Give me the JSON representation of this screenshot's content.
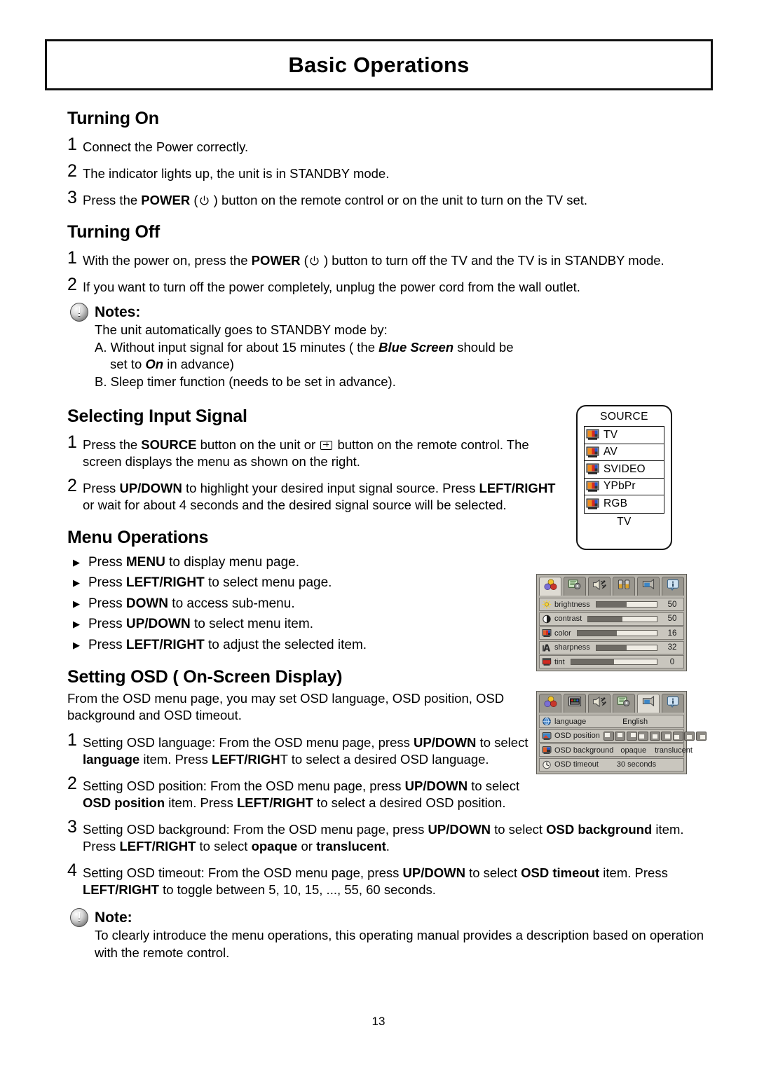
{
  "header": {
    "title": "Basic Operations"
  },
  "page": {
    "number": "13"
  },
  "sections": {
    "turning_on": {
      "heading": "Turning On",
      "steps": [
        {
          "num": "1",
          "text": "Connect the Power correctly."
        },
        {
          "num": "2",
          "text": "The indicator lights up, the unit is in STANDBY mode."
        },
        {
          "num": "3",
          "pre": "Press the ",
          "strong": "POWER",
          "mid": " (",
          "icon": "power-icon",
          "post": " ) button on the remote control or on the unit to turn on the TV set."
        }
      ]
    },
    "turning_off": {
      "heading": "Turning Off",
      "steps": [
        {
          "num": "1",
          "pre": "With the power on, press the ",
          "strong": "POWER",
          "mid": " (",
          "icon": "power-icon",
          "post": " ) button to turn off the TV and the TV is in STANDBY mode."
        },
        {
          "num": "2",
          "text": "If you want to turn off the power completely, unplug the power cord from the wall outlet."
        }
      ],
      "notes": {
        "title": "Notes:",
        "intro": "The unit automatically goes to STANDBY mode by:",
        "a_pre": "A. Without input signal for about 15 minutes ( the ",
        "a_em": "Blue Screen",
        "a_post": " should be",
        "a_line2_pre": "set to ",
        "a_line2_em": "On",
        "a_line2_post": " in advance)",
        "b": "B. Sleep timer function (needs to be set in advance)."
      }
    },
    "selecting_input": {
      "heading": "Selecting Input Signal",
      "steps": [
        {
          "num": "1",
          "pre": "Press the ",
          "strong": "SOURCE",
          "mid": " button on the unit or ",
          "icon": "source-button-icon",
          "post": " button on the remote control. The screen displays the menu as shown on the right."
        },
        {
          "num": "2",
          "pre": "Press ",
          "strong": "UP/DOWN",
          "mid": " to highlight your desired input signal source. Press ",
          "strong2": "LEFT/RIGHT",
          "post": " or wait for about 4 seconds and the desired signal source will be selected."
        }
      ]
    },
    "menu_operations": {
      "heading": "Menu Operations",
      "bullets": [
        {
          "pre": "Press ",
          "strong": "MENU",
          "post": " to display menu page."
        },
        {
          "pre": "Press ",
          "strong": "LEFT/RIGHT",
          "post": " to select menu page."
        },
        {
          "pre": "Press ",
          "strong": "DOWN",
          "post": " to access sub-menu."
        },
        {
          "pre": "Press ",
          "strong": "UP/DOWN",
          "post": " to select menu item."
        },
        {
          "pre": "Press ",
          "strong": "LEFT/RIGHT",
          "post": " to adjust the selected item."
        }
      ]
    },
    "setting_osd": {
      "heading": "Setting OSD ( On-Screen Display)",
      "intro": "From the OSD menu page, you may set OSD language, OSD position, OSD background and OSD timeout.",
      "steps": [
        {
          "num": "1",
          "p1": "Setting OSD language: From the OSD menu page, press ",
          "b1": "UP/DOWN",
          "p2": " to select ",
          "b2": "language",
          "p3": " item. Press ",
          "b3": "LEFT/RIGH",
          "p4": "T to select a desired OSD language."
        },
        {
          "num": "2",
          "p1": "Setting OSD position: From the OSD menu page, press ",
          "b1": "UP/DOWN",
          "p2": " to select ",
          "b2": "OSD position",
          "p3": " item. Press ",
          "b3": "LEFT/RIGHT",
          "p4": " to select a desired OSD position."
        },
        {
          "num": "3",
          "p1": "Setting OSD background: From the OSD menu page, press ",
          "b1": "UP/DOWN",
          "p2": " to select ",
          "b2": "OSD background",
          "p3": " item. Press ",
          "b3": "LEFT/RIGHT",
          "p4": " to select ",
          "b4": "opaque",
          "p5": " or ",
          "b5": "translucent",
          "p6": "."
        },
        {
          "num": "4",
          "p1": "Setting OSD timeout: From the OSD menu page, press ",
          "b1": "UP/DOWN",
          "p2": " to select ",
          "b2": "OSD timeout",
          "p3": " item. Press ",
          "b3": "LEFT/RIGHT",
          "p4": " to toggle between 5, 10, 15, ..., 55, 60 seconds."
        }
      ],
      "note": {
        "title": "Note:",
        "body": "To clearly introduce the menu operations, this operating manual provides a description based on operation with the remote control."
      }
    }
  },
  "source_menu": {
    "title": "SOURCE",
    "items": [
      {
        "label": "TV",
        "icon": "tv-icon"
      },
      {
        "label": "AV",
        "icon": "tv-icon"
      },
      {
        "label": "SVIDEO",
        "icon": "tv-icon"
      },
      {
        "label": "YPbPr",
        "icon": "tv-icon"
      },
      {
        "label": "RGB",
        "icon": "tv-icon"
      }
    ],
    "footer": "TV"
  },
  "picture_osd": {
    "tabs": [
      {
        "icon": "picture-balls-icon",
        "selected": true
      },
      {
        "icon": "setup-screen-gear-icon",
        "selected": false
      },
      {
        "icon": "sound-speaker-icon",
        "selected": false
      },
      {
        "icon": "channel-binoculars-icon",
        "selected": false
      },
      {
        "icon": "osd-screen-icon",
        "selected": false
      },
      {
        "icon": "information-icon",
        "selected": false
      }
    ],
    "rows": [
      {
        "icon": "brightness-icon",
        "label": "brightness",
        "value": "50",
        "fill": 50
      },
      {
        "icon": "contrast-icon",
        "label": "contrast",
        "value": "50",
        "fill": 50
      },
      {
        "icon": "color-icon",
        "label": "color",
        "value": "16",
        "fill": 50
      },
      {
        "icon": "sharpness-icon",
        "label": "sharpness",
        "value": "32",
        "fill": 50
      },
      {
        "icon": "tint-icon",
        "label": "tint",
        "value": "0",
        "fill": 50
      }
    ]
  },
  "osd_osd": {
    "tabs": [
      {
        "icon": "picture-balls-icon",
        "selected": false
      },
      {
        "icon": "screen-pixels-icon",
        "selected": false
      },
      {
        "icon": "sound-speaker-icon",
        "selected": false
      },
      {
        "icon": "setup-screen-gear-icon",
        "selected": false
      },
      {
        "icon": "osd-screen-icon",
        "selected": true
      },
      {
        "icon": "information-icon",
        "selected": false
      }
    ],
    "rows": {
      "language": {
        "icon": "globe-icon",
        "label": "language",
        "value": "English"
      },
      "position": {
        "icon": "osd-position-icon",
        "label": "OSD position",
        "boxes": 9,
        "selected_index": 5
      },
      "background": {
        "icon": "osd-background-icon",
        "label": "OSD background",
        "option_1": "opaque",
        "option_2": "translucent"
      },
      "timeout": {
        "icon": "clock-icon",
        "label": "OSD timeout",
        "value": "30 seconds"
      }
    }
  },
  "colors": {
    "osd_panel_bg": "#b8b5ad",
    "osd_row_bg": "#c9c6be",
    "osd_tab_bg": "#9a978f",
    "osd_tab_selected_bg": "#dedbd3",
    "slider_fill": "#6e6b65",
    "ink": "#000000"
  }
}
